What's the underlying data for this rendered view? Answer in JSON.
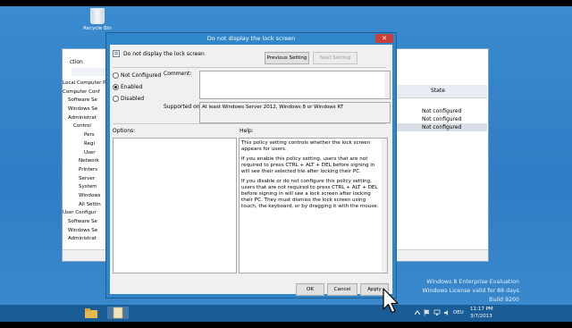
{
  "desktop": {
    "recycle_bin_label": "Recycle Bin",
    "watermark": {
      "line1": "Windows 8 Enterprise Evaluation",
      "line2": "Windows License valid for 88 days",
      "line3": "Build 9200"
    }
  },
  "gpe": {
    "menu_label": "ction",
    "tree": [
      "Local Computer Po",
      "Computer Conf",
      "Software Se",
      "Windows Se",
      "Administrat",
      "Control",
      "Pers",
      "Regi",
      "User",
      "Network",
      "Printers",
      "Server",
      "System",
      "Windows",
      "All Settin",
      "User Configur",
      "Software Se",
      "Windows Se",
      "Administrat"
    ],
    "state_header": "State",
    "states": [
      "Not configured",
      "Not configured",
      "Not configured"
    ]
  },
  "dialog": {
    "title": "Do not display the lock screen",
    "close_glyph": "✕",
    "setting_name": "Do not display the lock screen",
    "prev_button": "Previous Setting",
    "next_button": "Next Setting",
    "radio_not_configured": "Not Configured",
    "radio_enabled": "Enabled",
    "radio_disabled": "Disabled",
    "selected_option": "Enabled",
    "comment_label": "Comment:",
    "comment_value": "",
    "supported_label": "Supported on:",
    "supported_value": "At least Windows Server 2012, Windows 8 or Windows RT",
    "options_label": "Options:",
    "help_label": "Help:",
    "help_paragraphs": [
      "This policy setting controls whether the lock screen appears for users.",
      "If you enable this policy setting, users that are not required to press CTRL + ALT + DEL before signing in will see their selected tile after  locking their PC.",
      "If you disable or do not configure this policy setting, users that are not required to press CTRL + ALT + DEL before signing in will see a lock screen after locking their PC. They must dismiss the lock screen using touch, the keyboard, or by dragging it with the mouse."
    ],
    "ok_button": "OK",
    "cancel_button": "Cancel",
    "apply_button": "Apply"
  },
  "taskbar": {
    "language": "DEU",
    "time": "11:17 PM",
    "date": "3/7/2013"
  },
  "colors": {
    "desktop": "#2f7dc4",
    "dialog_frame": "#2f86c9",
    "close": "#c7403a",
    "taskbar": "#1a5c96"
  }
}
